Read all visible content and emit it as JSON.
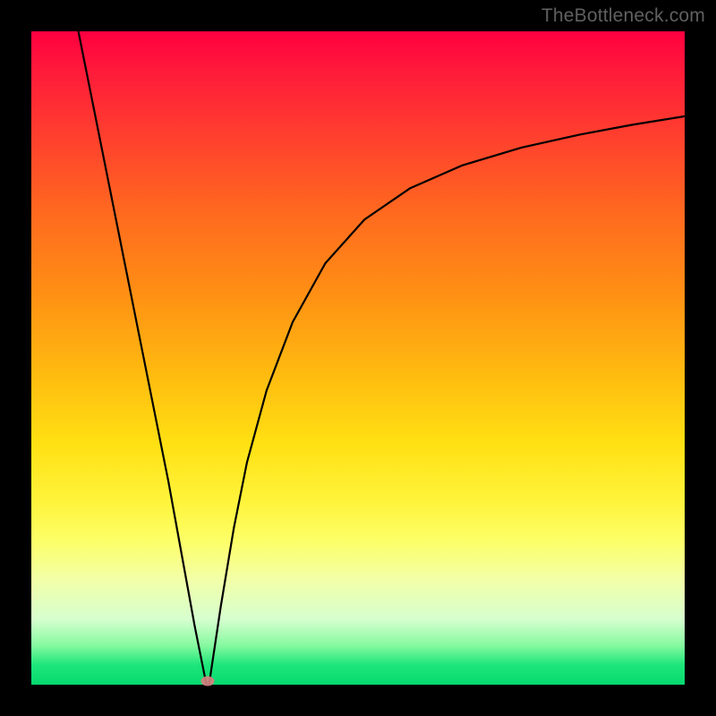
{
  "watermark": "TheBottleneck.com",
  "marker": {
    "x_frac": 0.27,
    "y_frac": 0.994
  },
  "chart_data": {
    "type": "line",
    "title": "",
    "xlabel": "",
    "ylabel": "",
    "xlim": [
      0,
      1
    ],
    "ylim": [
      0,
      1
    ],
    "series": [
      {
        "name": "left-branch",
        "x": [
          0.072,
          0.09,
          0.11,
          0.13,
          0.15,
          0.17,
          0.19,
          0.21,
          0.23,
          0.25,
          0.268
        ],
        "y": [
          1.0,
          0.91,
          0.81,
          0.71,
          0.61,
          0.51,
          0.41,
          0.31,
          0.2,
          0.09,
          0.0
        ]
      },
      {
        "name": "right-branch",
        "x": [
          0.272,
          0.29,
          0.31,
          0.33,
          0.36,
          0.4,
          0.45,
          0.51,
          0.58,
          0.66,
          0.75,
          0.84,
          0.92,
          1.0
        ],
        "y": [
          0.0,
          0.12,
          0.24,
          0.34,
          0.45,
          0.555,
          0.645,
          0.712,
          0.76,
          0.795,
          0.822,
          0.842,
          0.857,
          0.87
        ]
      }
    ],
    "marker_points": [
      {
        "x": 0.27,
        "y": 0.006
      }
    ],
    "background_gradient": {
      "top": "#ff0040",
      "upper_mid": "#ff8f14",
      "mid": "#ffe012",
      "lower_mid": "#f2ffa8",
      "bottom": "#06d96f"
    }
  }
}
